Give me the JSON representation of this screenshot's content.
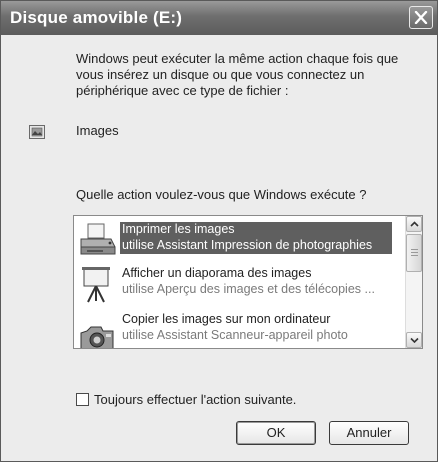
{
  "window": {
    "title": "Disque amovible (E:)"
  },
  "description": {
    "line1": "Windows peut exécuter la même action chaque fois que",
    "line2": "vous insérez un disque ou que vous connectez un",
    "line3": "périphérique avec ce type de fichier :"
  },
  "file_type": {
    "label": "Images",
    "icon": "image-file-icon"
  },
  "question": "Quelle action voulez-vous que Windows exécute ?",
  "actions": [
    {
      "title": "Imprimer les images",
      "subtitle": "utilise Assistant Impression de photographies",
      "icon": "printer-icon",
      "selected": true
    },
    {
      "title": "Afficher un diaporama des images",
      "subtitle": "utilise Aperçu des images et des télécopies ...",
      "icon": "slideshow-icon",
      "selected": false
    },
    {
      "title": "Copier les images sur mon ordinateur",
      "subtitle": "utilise Assistant Scanneur-appareil photo",
      "icon": "camera-icon",
      "selected": false
    }
  ],
  "always_action": {
    "label": "Toujours effectuer l'action suivante.",
    "checked": false
  },
  "buttons": {
    "ok": "OK",
    "cancel": "Annuler"
  }
}
